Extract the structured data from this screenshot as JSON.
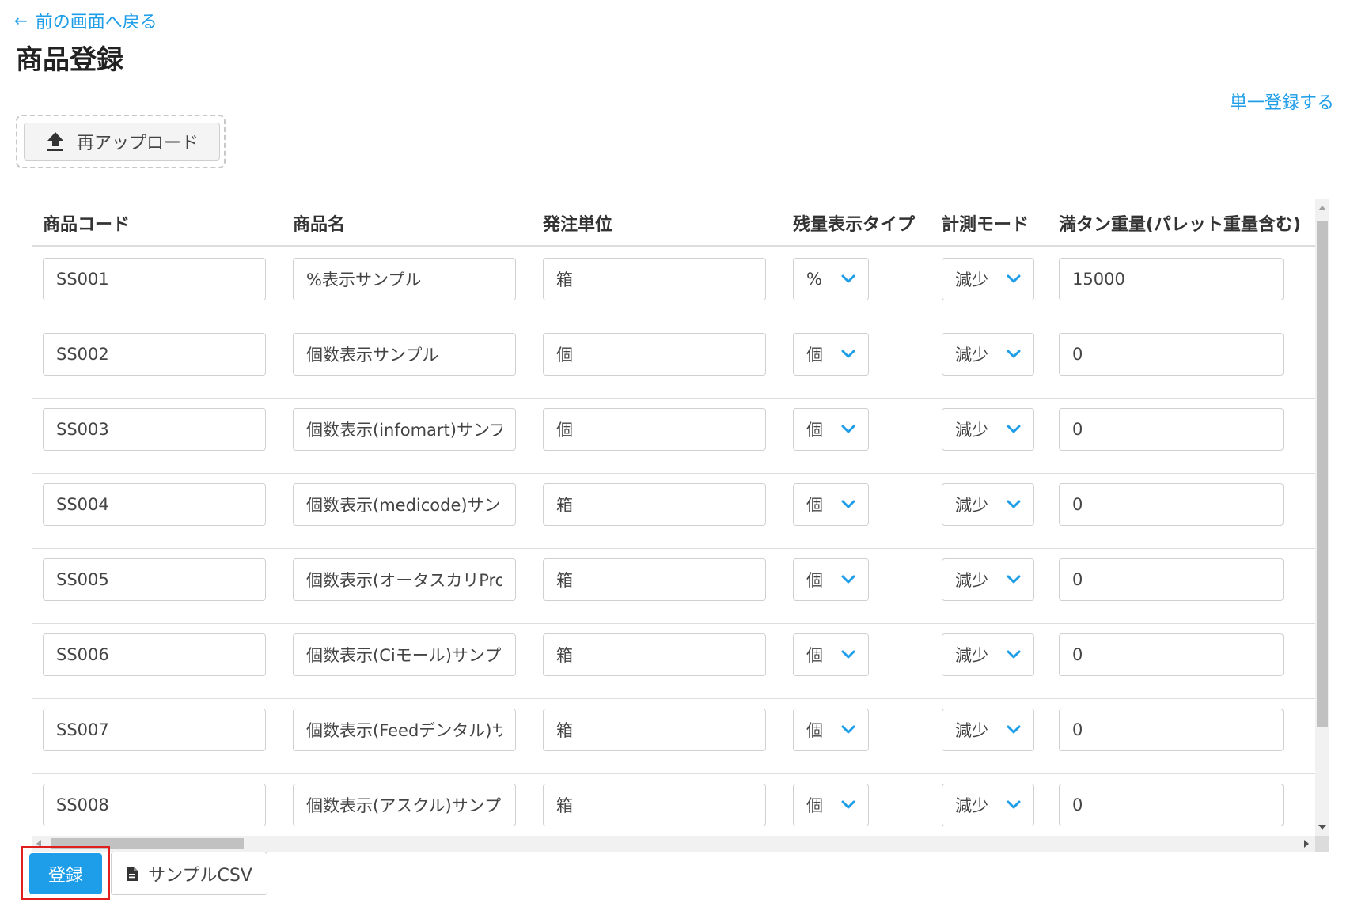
{
  "nav": {
    "back_arrow": "←",
    "back_label": "前の画面へ戻る",
    "single_register_label": "単一登録する"
  },
  "page": {
    "title": "商品登録"
  },
  "upload": {
    "label": "再アップロード",
    "icon": "upload-icon"
  },
  "table": {
    "headers": {
      "code": "商品コード",
      "name": "商品名",
      "unit": "発注単位",
      "display_type": "残量表示タイプ",
      "mode": "計測モード",
      "weight": "満タン重量(パレット重量含む)"
    },
    "rows": [
      {
        "code": "SS001",
        "name": "%表示サンプル",
        "unit": "箱",
        "display_type": "%",
        "mode": "減少",
        "weight": "15000"
      },
      {
        "code": "SS002",
        "name": "個数表示サンプル",
        "unit": "個",
        "display_type": "個",
        "mode": "減少",
        "weight": "0"
      },
      {
        "code": "SS003",
        "name": "個数表示(infomart)サンプ",
        "unit": "個",
        "display_type": "個",
        "mode": "減少",
        "weight": "0"
      },
      {
        "code": "SS004",
        "name": "個数表示(medicode)サンプ",
        "unit": "箱",
        "display_type": "個",
        "mode": "減少",
        "weight": "0"
      },
      {
        "code": "SS005",
        "name": "個数表示(オータスカリPro",
        "unit": "箱",
        "display_type": "個",
        "mode": "減少",
        "weight": "0"
      },
      {
        "code": "SS006",
        "name": "個数表示(Ciモール)サンプ",
        "unit": "箱",
        "display_type": "個",
        "mode": "減少",
        "weight": "0"
      },
      {
        "code": "SS007",
        "name": "個数表示(Feedデンタル)サ",
        "unit": "箱",
        "display_type": "個",
        "mode": "減少",
        "weight": "0"
      },
      {
        "code": "SS008",
        "name": "個数表示(アスクル)サンプ",
        "unit": "箱",
        "display_type": "個",
        "mode": "減少",
        "weight": "0"
      }
    ]
  },
  "actions": {
    "register_label": "登録",
    "sample_csv_label": "サンプルCSV",
    "sample_csv_icon": "file-icon"
  },
  "colors": {
    "accent": "#1e9de8",
    "highlight": "#e02020",
    "border": "#d0d0d0"
  }
}
